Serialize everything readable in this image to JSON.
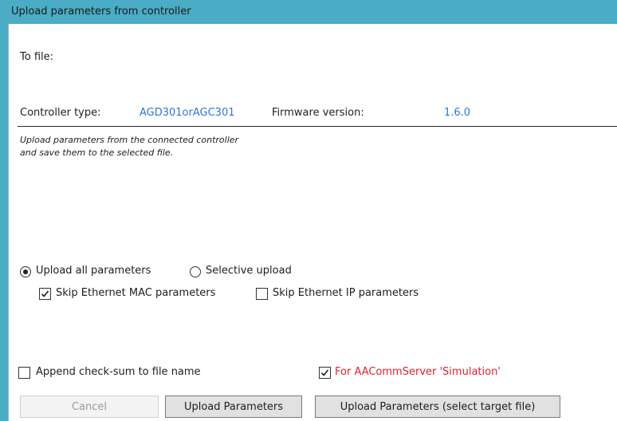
{
  "window": {
    "title": "Upload parameters from controller"
  },
  "file": {
    "to_file_label": "To file:"
  },
  "controller": {
    "type_label": "Controller type:",
    "type_value": "AGD301orAGC301",
    "firmware_label": "Firmware version:",
    "firmware_value": "1.6.0"
  },
  "description": {
    "line1": "Upload parameters from the connected controller",
    "line2": "and save them to the selected file."
  },
  "upload_mode": {
    "all_label": "Upload all parameters",
    "all_selected": true,
    "selective_label": "Selective upload",
    "selective_selected": false
  },
  "skip_options": {
    "mac_label": "Skip Ethernet MAC parameters",
    "mac_checked": true,
    "ip_label": "Skip Ethernet IP parameters",
    "ip_checked": false
  },
  "bottom_options": {
    "checksum_label": "Append check-sum to file name",
    "checksum_checked": false,
    "simulation_label": "For AACommServer 'Simulation'",
    "simulation_checked": true,
    "simulation_color": "#e0202a"
  },
  "buttons": {
    "cancel": "Cancel",
    "upload": "Upload Parameters",
    "upload_select": "Upload Parameters (select target file)"
  },
  "colors": {
    "titlebar": "#4aacc5",
    "value_blue": "#2e75d6"
  }
}
